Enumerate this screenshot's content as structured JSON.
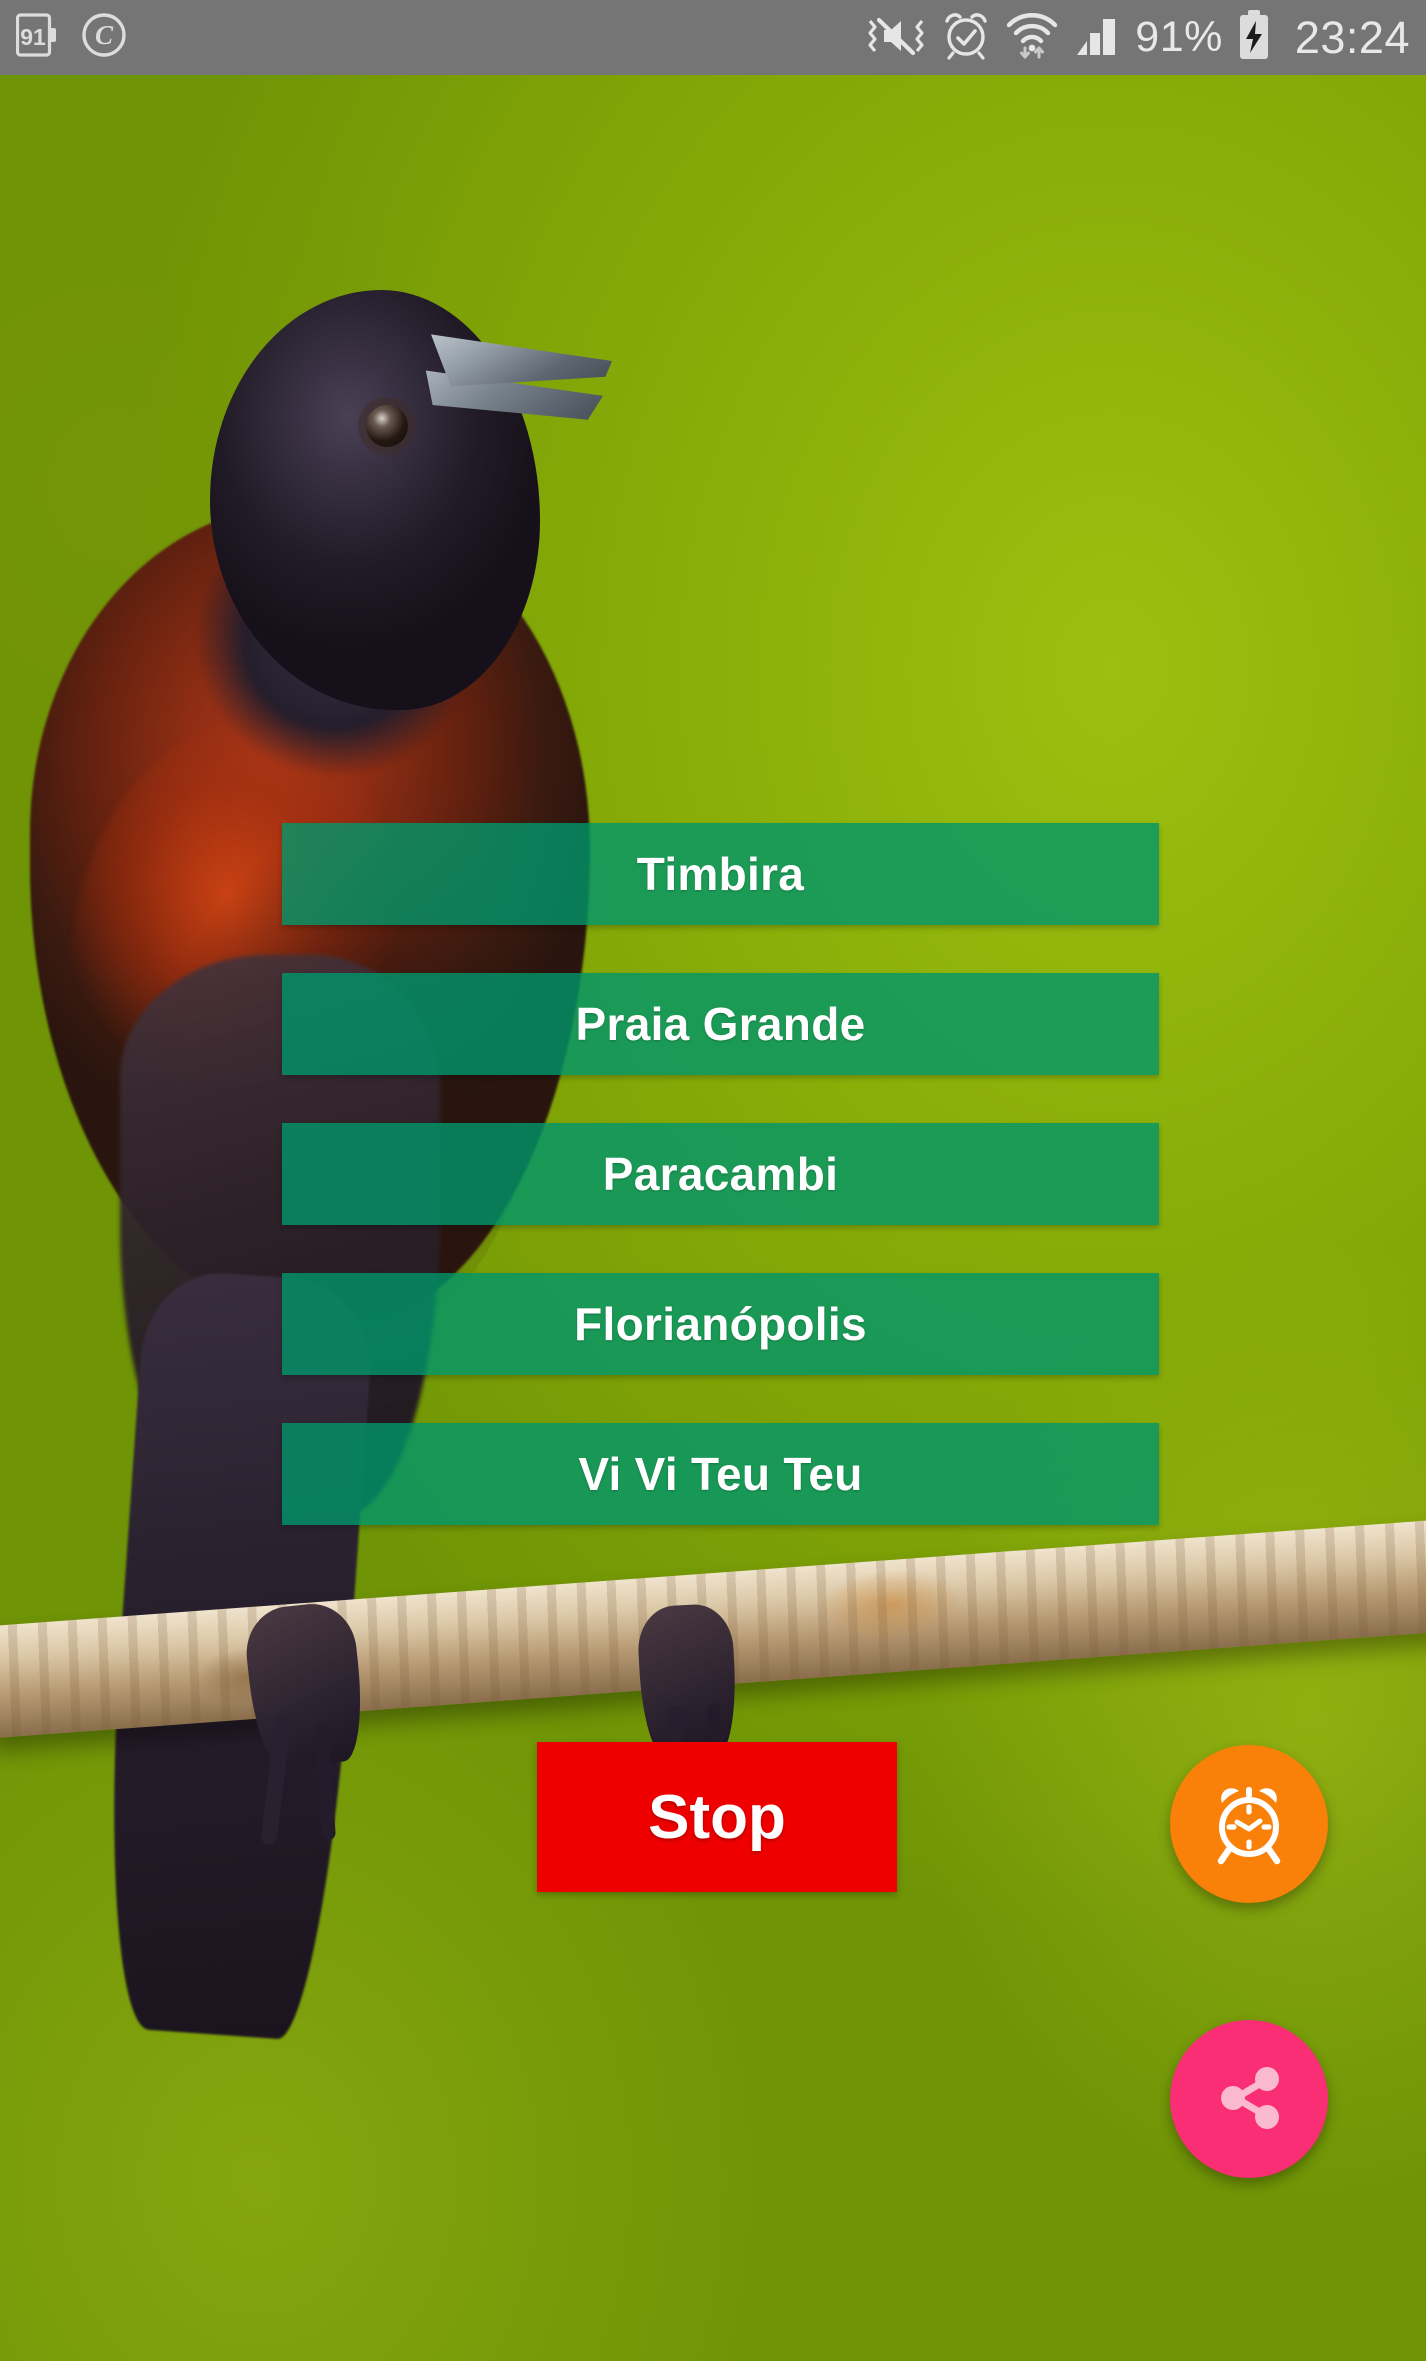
{
  "status_bar": {
    "background_color": "#757575",
    "text_color": "#e8e8e8",
    "left_icons": [
      {
        "name": "data-saver-91-icon",
        "label": "91"
      },
      {
        "name": "copyright-circle-icon",
        "label": "C"
      }
    ],
    "right_icons": [
      {
        "name": "vibrate-mute-icon"
      },
      {
        "name": "alarm-clock-icon"
      },
      {
        "name": "wifi-transfer-icon"
      },
      {
        "name": "cellular-signal-icon"
      },
      {
        "name": "battery-charging-icon"
      }
    ],
    "battery_percent": "91%",
    "clock": "23:24"
  },
  "background": {
    "name": "bird-photo",
    "description": "Chestnut-bellied seed finch perched on branch",
    "foliage_color": "#93b90e"
  },
  "sound_list": {
    "button_color": "#00966a",
    "label_color": "#ffffff",
    "items": [
      {
        "label": "Timbira"
      },
      {
        "label": "Praia Grande"
      },
      {
        "label": "Paracambi"
      },
      {
        "label": "Florianópolis"
      },
      {
        "label": "Vi Vi Teu Teu"
      }
    ]
  },
  "stop": {
    "label": "Stop",
    "color": "#ee0000",
    "label_color": "#ffffff"
  },
  "fabs": [
    {
      "name": "alarm-fab",
      "icon": "alarm-clock-icon",
      "color": "#f98009"
    },
    {
      "name": "share-fab",
      "icon": "share-icon",
      "color": "#f92e74"
    }
  ]
}
